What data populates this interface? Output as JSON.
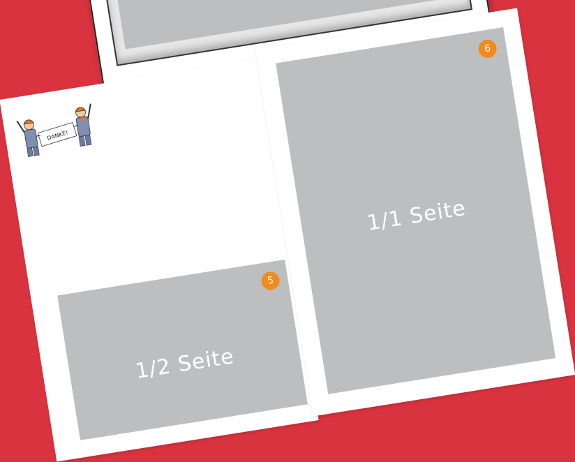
{
  "colors": {
    "background": "#d9333f",
    "page": "#ffffff",
    "ad_placeholder": "#bdbec0",
    "badge": "#f28a1d"
  },
  "illustration": {
    "sign_text": "DANKE!"
  },
  "pages": {
    "left": {
      "ad": {
        "label": "1/2 Seite",
        "badge": "5"
      }
    },
    "right": {
      "ad": {
        "label": "1/1 Seite",
        "badge": "6"
      }
    }
  }
}
